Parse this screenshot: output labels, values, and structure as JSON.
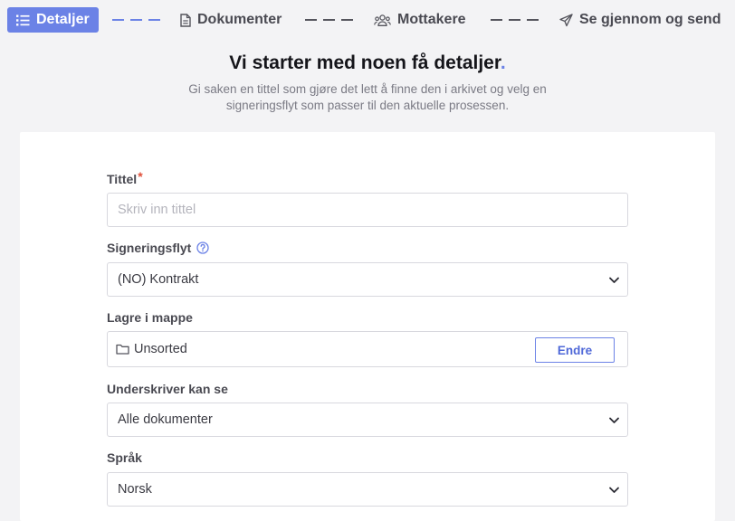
{
  "stepper": {
    "steps": [
      {
        "label": "Detaljer",
        "icon": "list-icon",
        "active": true
      },
      {
        "label": "Dokumenter",
        "icon": "document-icon",
        "active": false
      },
      {
        "label": "Mottakere",
        "icon": "users-icon",
        "active": false
      },
      {
        "label": "Se gjennom og send",
        "icon": "send-icon",
        "active": false
      }
    ]
  },
  "header": {
    "title": "Vi starter med noen få detaljer",
    "title_dot": ".",
    "subtitle": "Gi saken en tittel som gjøre det lett å finne den i arkivet og velg en signeringsflyt som passer til den aktuelle prosessen."
  },
  "form": {
    "title": {
      "label": "Tittel",
      "required_mark": "*",
      "placeholder": "Skriv inn tittel",
      "value": ""
    },
    "signing_flow": {
      "label": "Signeringsflyt",
      "help_icon": "help-circle-icon",
      "value": "(NO) Kontrakt"
    },
    "folder": {
      "label": "Lagre i mappe",
      "value": "Unsorted",
      "change_label": "Endre"
    },
    "signer_can_see": {
      "label": "Underskriver kan se",
      "value": "Alle dokumenter"
    },
    "language": {
      "label": "Språk",
      "value": "Norsk"
    }
  },
  "colors": {
    "accent": "#6b82e6",
    "background": "#f3f3f5",
    "required": "#e0503a"
  }
}
